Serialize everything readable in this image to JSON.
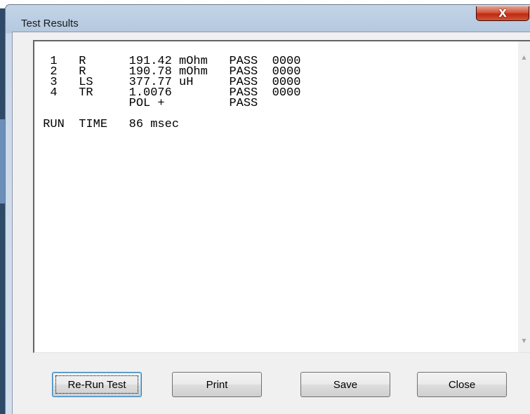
{
  "window": {
    "title": "Test Results",
    "close_glyph": "X"
  },
  "results": {
    "lines": [
      "  1   R      191.42 mOhm   PASS  0000",
      "  2   R      190.78 mOhm   PASS  0000",
      "  3   LS     377.77 uH     PASS  0000",
      "  4   TR     1.0076        PASS  0000",
      "             POL +         PASS",
      "",
      " RUN  TIME   86 msec"
    ]
  },
  "buttons": {
    "rerun": "Re-Run Test",
    "print": "Print",
    "save": "Save",
    "close": "Close"
  },
  "icons": {
    "scroll_up": "scroll-up-arrow-icon",
    "scroll_down": "scroll-down-arrow-icon",
    "close": "close-icon"
  }
}
